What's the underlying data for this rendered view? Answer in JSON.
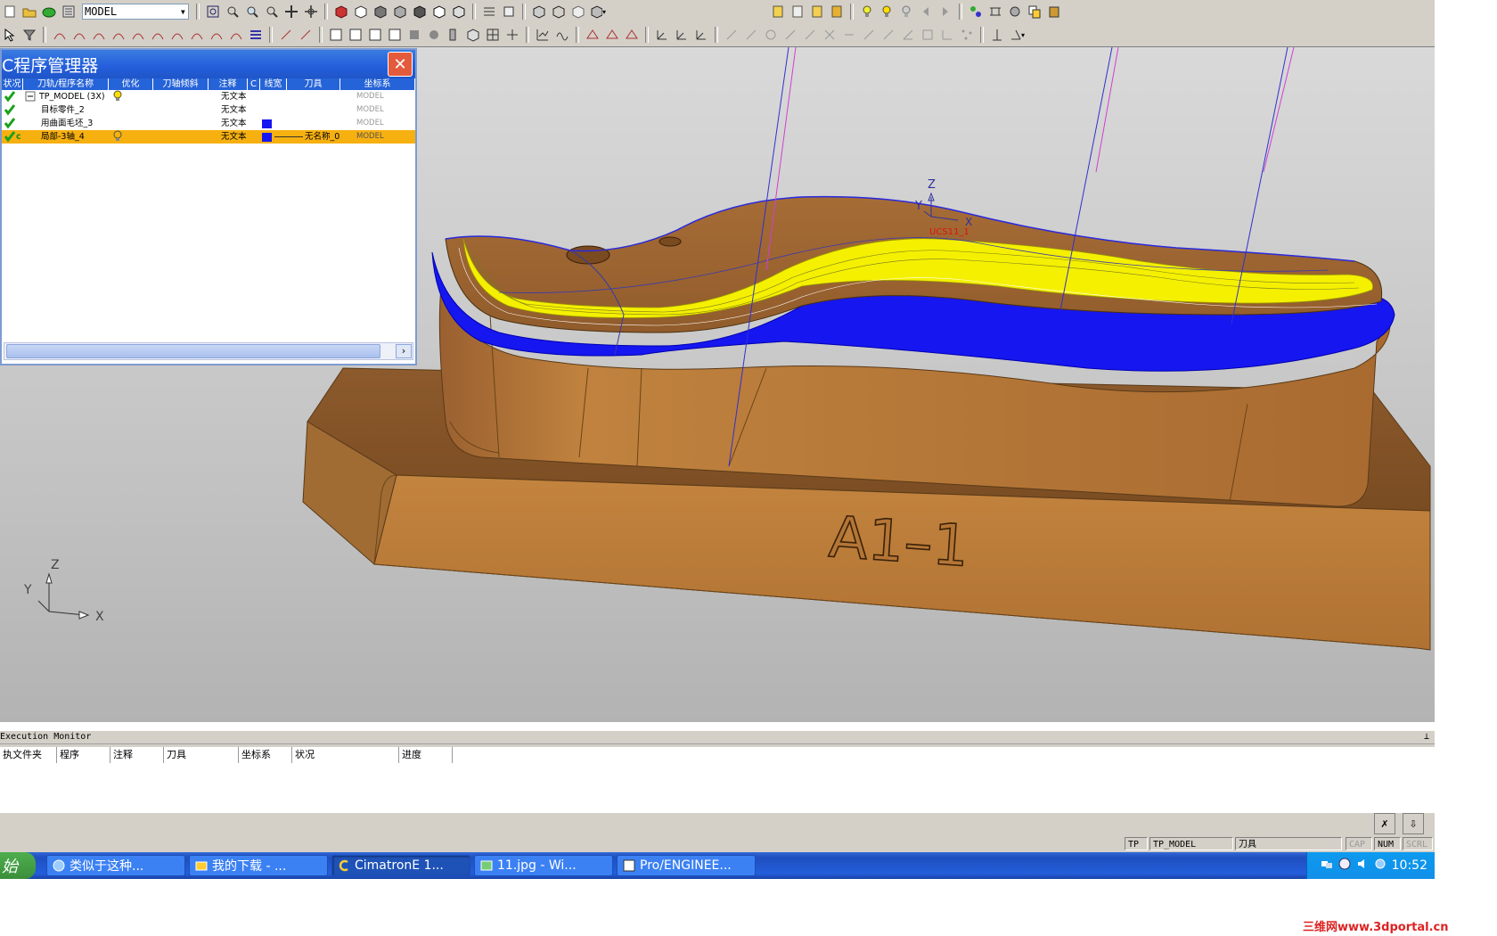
{
  "toolbar": {
    "model_select": "MODEL"
  },
  "viewport": {
    "part_label": "A1–1",
    "axes_bottom": {
      "x": "X",
      "y": "Y",
      "z": "Z"
    },
    "axes_ucs": {
      "x": "X",
      "y": "Y",
      "z": "Z",
      "name": "UCS11_1"
    },
    "colors": {
      "background": "#c8c8c8",
      "part": "#b5763a",
      "toolpath_yellow": "#f5f000",
      "toolpath_blue": "#1616f0",
      "toolpath_magenta": "#d040d0"
    }
  },
  "nc_manager": {
    "title": "C程序管理器",
    "columns": [
      "状况",
      "刀轨/程序名称",
      "优化",
      "刀轴倾斜",
      "注释",
      "C",
      "线宽",
      "刀具",
      "坐标系"
    ],
    "rows": [
      {
        "name": "TP_MODEL (3X)",
        "note": "无文本",
        "tool": "",
        "coord": "MODEL",
        "selected": false
      },
      {
        "name": "目标零件_2",
        "note": "无文本",
        "tool": "",
        "coord": "MODEL",
        "selected": false
      },
      {
        "name": "用曲面毛坯_3",
        "note": "无文本",
        "tool": "",
        "coord": "MODEL",
        "selected": false
      },
      {
        "name": "局部-3轴_4",
        "note": "无文本",
        "tool": "无名称_0",
        "coord": "MODEL",
        "selected": true
      }
    ],
    "status_flag": "c"
  },
  "exec_monitor": {
    "title": "Execution Monitor",
    "pin": "⊥",
    "columns": [
      "执文件夹",
      "程序",
      "注释",
      "刀具",
      "坐标系",
      "状况",
      "进度"
    ]
  },
  "statusbar": {
    "mode": "TP",
    "model": "TP_MODEL",
    "tool_label": "刀具",
    "cap": "CAP",
    "num": "NUM",
    "scrl": "SCRL"
  },
  "taskbar": {
    "start": "始",
    "tasks": [
      {
        "label": "类似于这种...",
        "active": false
      },
      {
        "label": "我的下载 - ...",
        "active": false
      },
      {
        "label": "CimatronE 1...",
        "active": true
      },
      {
        "label": "11.jpg - Wi...",
        "active": false
      },
      {
        "label": "Pro/ENGINEE...",
        "active": false
      }
    ],
    "clock": "10:52"
  },
  "watermark": "三维网www.3dportal.cn"
}
